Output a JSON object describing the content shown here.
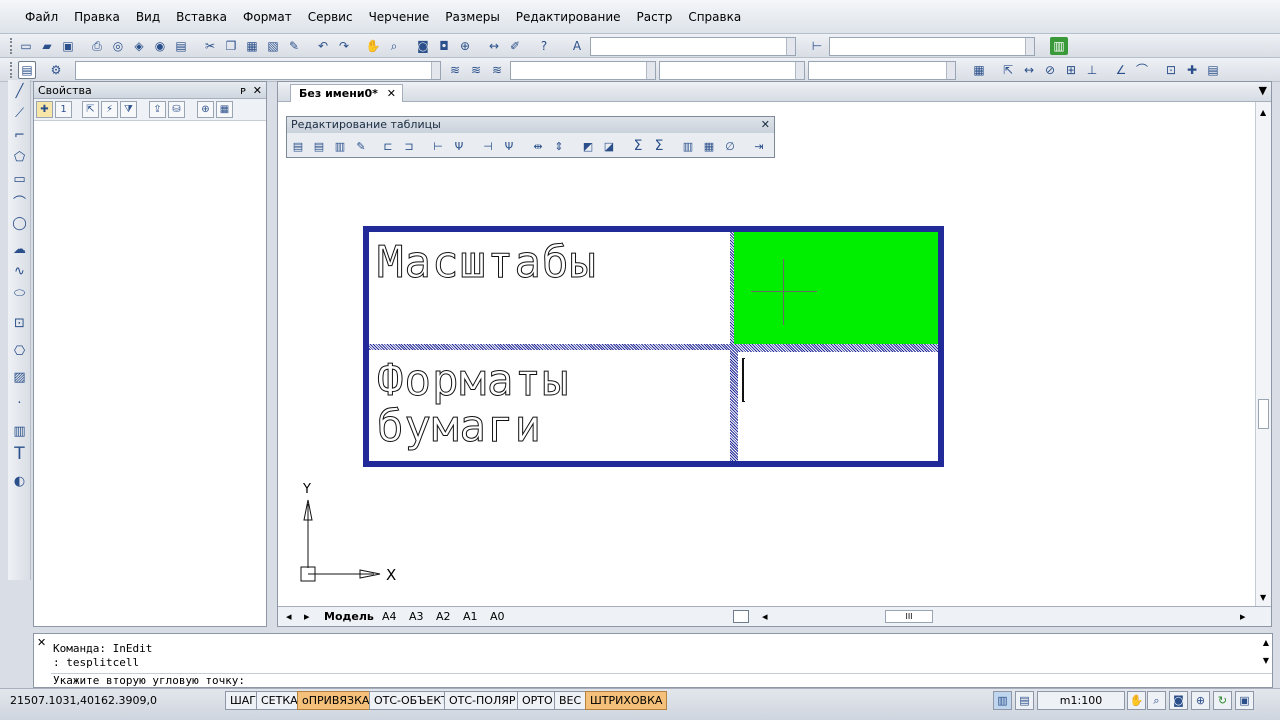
{
  "menu": [
    "Файл",
    "Правка",
    "Вид",
    "Вставка",
    "Формат",
    "Сервис",
    "Черчение",
    "Размеры",
    "Редактирование",
    "Растр",
    "Справка"
  ],
  "properties_panel": {
    "title": "Свойства",
    "pin": "ᴘ",
    "close": "✕"
  },
  "document_tab": {
    "label": "Без имени0*",
    "close": "✕"
  },
  "table_edit_toolbar": {
    "title": "Редактирование таблицы",
    "close": "✕"
  },
  "cad_table": {
    "cells": [
      {
        "text": "Масштабы",
        "highlighted": false
      },
      {
        "text": "",
        "highlighted": true
      },
      {
        "text_line1": "Форматы",
        "text_line2": "бумаги",
        "highlighted": false
      },
      {
        "text": "",
        "highlighted": false
      }
    ],
    "highlight_color": "#00ee00",
    "border_color": "#222a9a"
  },
  "ucs": {
    "x_label": "X",
    "y_label": "Y"
  },
  "layout_tabs": [
    "Модель",
    "A4",
    "A3",
    "A2",
    "A1",
    "A0"
  ],
  "active_layout_tab": "Модель",
  "hscroll_thumb_label": "III",
  "command_window": {
    "lines": [
      "Команда: InEdit",
      ": tesplitcell",
      "Укажите вторую угловую точку:"
    ],
    "close": "✕"
  },
  "status_bar": {
    "coordinates": "21507.1031,40162.3909,0",
    "modes": [
      {
        "label": "ШАГ",
        "on": false
      },
      {
        "label": "СЕТКА",
        "on": false
      },
      {
        "label": "оПРИВЯЗКА",
        "on": true
      },
      {
        "label": "ОТС-ОБЪЕКТ",
        "on": false
      },
      {
        "label": "ОТС-ПОЛЯР",
        "on": false
      },
      {
        "label": "ОРТО",
        "on": false
      },
      {
        "label": "ВЕС",
        "on": false
      },
      {
        "label": "ШТРИХОВКА",
        "on": true
      }
    ],
    "scale": "m1:100"
  },
  "colors": {
    "accent_on": "#f5c17a",
    "selection_green": "#00ee00",
    "table_blue": "#222a9a"
  }
}
